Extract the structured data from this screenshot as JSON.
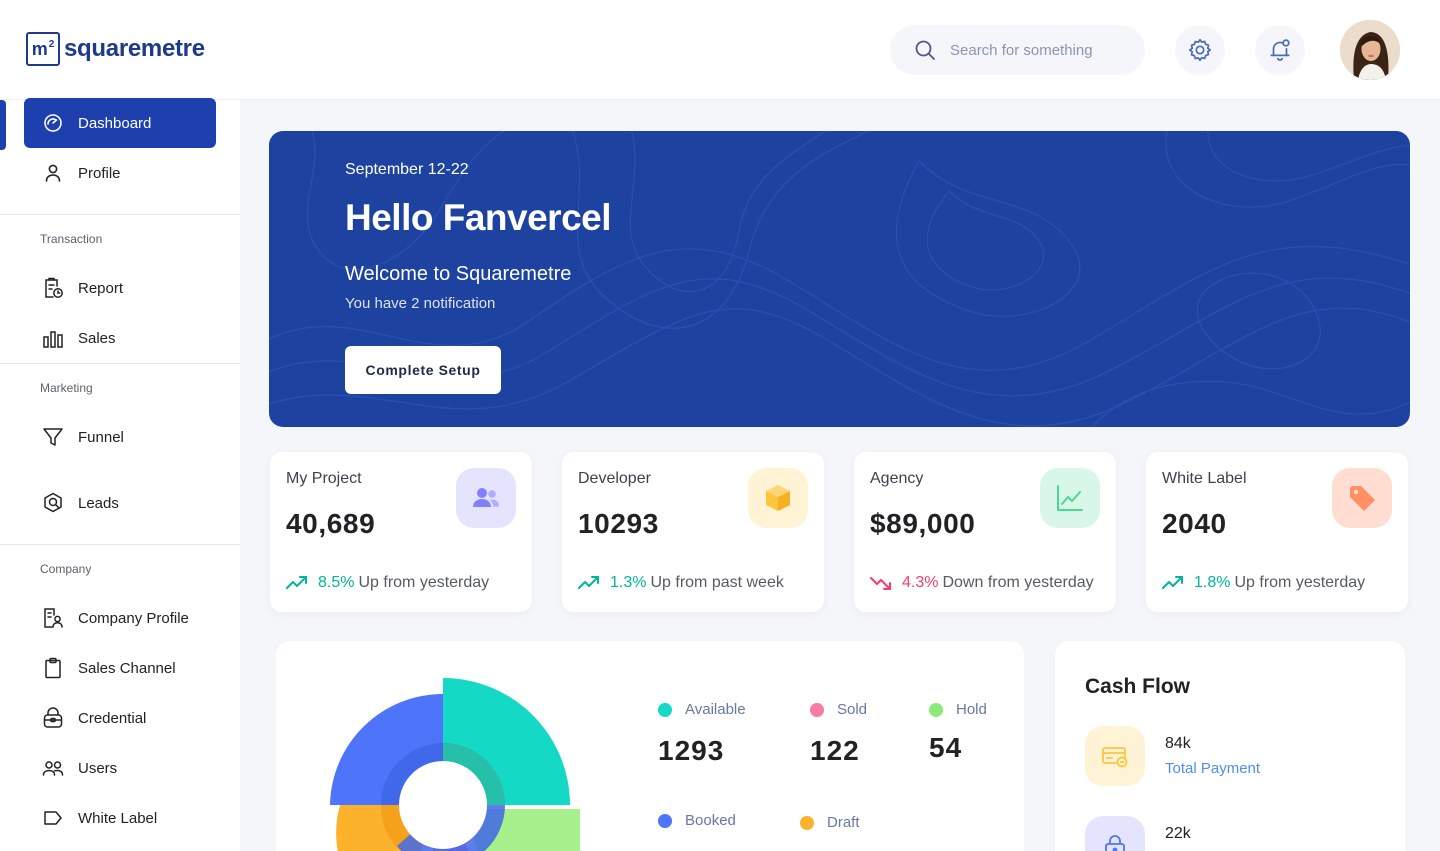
{
  "brand": {
    "mark": "m",
    "mark_sup": "2",
    "name": "squaremetre",
    "color": "#1E3A8A"
  },
  "header": {
    "search_placeholder": "Search for something",
    "icons": [
      "search-icon",
      "settings-icon",
      "notification-bell-icon"
    ]
  },
  "sidebar": {
    "items": [
      {
        "label": "Dashboard",
        "icon": "dashboard-gauge-icon",
        "active": true
      },
      {
        "label": "Profile",
        "icon": "user-icon"
      }
    ],
    "sections": [
      {
        "title": "Transaction",
        "items": [
          {
            "label": "Report",
            "icon": "report-icon"
          },
          {
            "label": "Sales",
            "icon": "bar-chart-icon"
          }
        ]
      },
      {
        "title": "Marketing",
        "items": [
          {
            "label": "Funnel",
            "icon": "funnel-icon"
          },
          {
            "label": "Leads",
            "icon": "leads-icon"
          }
        ]
      },
      {
        "title": "Company",
        "items": [
          {
            "label": "Company Profile",
            "icon": "company-profile-icon"
          },
          {
            "label": "Sales Channel",
            "icon": "clipboard-icon"
          },
          {
            "label": "Credential",
            "icon": "lock-bag-icon"
          },
          {
            "label": "Users",
            "icon": "users-icon"
          },
          {
            "label": "White Label",
            "icon": "label-tag-icon"
          }
        ]
      }
    ],
    "accent": "#1E40AF"
  },
  "hero": {
    "date": "September 12-22",
    "title": "Hello Fanvercel",
    "subtitle": "Welcome to Squaremetre",
    "note": "You have 2 notification",
    "button": "Complete Setup",
    "background": "#1E429F"
  },
  "stats": [
    {
      "title": "My Project",
      "value": "40,689",
      "pct": "8.5%",
      "trend_text": "Up from yesterday",
      "direction": "up",
      "icon": "users-icon",
      "icon_bg": "#E5E4FF",
      "icon_color": "#8280FF"
    },
    {
      "title": "Developer",
      "value": "10293",
      "pct": "1.3%",
      "trend_text": "Up from past week",
      "direction": "up",
      "icon": "box-icon",
      "icon_bg": "#FFF3D6",
      "icon_color": "#FEC53D"
    },
    {
      "title": "Agency",
      "value": "$89,000",
      "pct": "4.3%",
      "trend_text": "Down from yesterday",
      "direction": "down",
      "icon": "line-chart-icon",
      "icon_bg": "#D9F7E8",
      "icon_color": "#4AD991"
    },
    {
      "title": "White Label",
      "value": "2040",
      "pct": "1.8%",
      "trend_text": "Up from yesterday",
      "direction": "up",
      "icon": "tag-icon",
      "icon_bg": "#FFDED1",
      "icon_color": "#FF9066"
    }
  ],
  "property_status": {
    "legend": [
      {
        "label": "Available",
        "value": "1293",
        "color": "#14D9C5"
      },
      {
        "label": "Sold",
        "value": "122",
        "color": "#F87BA5"
      },
      {
        "label": "Hold",
        "value": "54",
        "color": "#8BEA7B"
      },
      {
        "label": "Booked",
        "value": "",
        "color": "#4E74F9"
      },
      {
        "label": "Draft",
        "value": "",
        "color": "#FDB22C"
      }
    ]
  },
  "cash_flow": {
    "title": "Cash Flow",
    "items": [
      {
        "amount": "84k",
        "label": "Total Payment",
        "icon": "payment-card-icon",
        "icon_bg": "#FFF3D6",
        "icon_color": "#FEC53D"
      },
      {
        "amount": "22k",
        "label": "",
        "icon": "lock-icon",
        "icon_bg": "#E5E4FF",
        "icon_color": "#4E74F9"
      }
    ]
  }
}
